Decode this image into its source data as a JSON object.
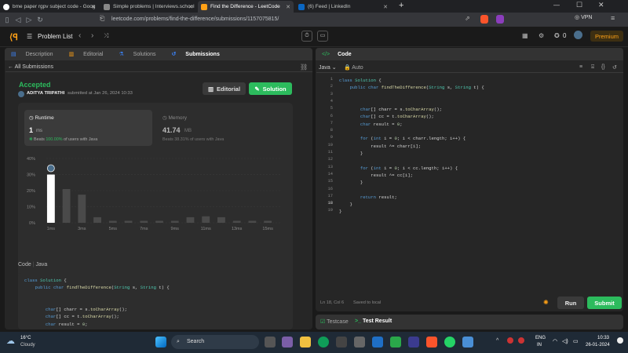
{
  "browser": {
    "tabs": [
      {
        "title": "bme paper rgpv subject code - Goog",
        "color": "#ffffff"
      },
      {
        "title": "Simple problems | Interviews.school",
        "color": "#bbbbbb"
      },
      {
        "title": "Find the Difference - LeetCode",
        "color": "#ffa116"
      },
      {
        "title": "(6) Feed | LinkedIn",
        "color": "#0a66c2"
      }
    ],
    "url": "leetcode.com/problems/find-the-difference/submissions/1157075815/",
    "vpn": "VPN"
  },
  "header": {
    "problem_list": "Problem List",
    "streak": "0",
    "premium": "Premium"
  },
  "left": {
    "tabs": [
      "Description",
      "Editorial",
      "Solutions",
      "Submissions"
    ],
    "back": "All Submissions",
    "status": "Accepted",
    "user": "ADITYA TRIPATHI",
    "submitted": "submitted at Jan 26, 2024 10:33",
    "editorial_btn": "Editorial",
    "solution_btn": "Solution",
    "runtime": {
      "label": "Runtime",
      "value": "1",
      "unit": "ms",
      "beats_prefix": "Beats",
      "beats_pct": "100.00%",
      "beats_suffix": "of users with Java"
    },
    "memory": {
      "label": "Memory",
      "value": "41.74",
      "unit": "MB",
      "beats": "Beats 38.31% of users with Java"
    },
    "code_label": "Code",
    "lang": "Java"
  },
  "chart_data": {
    "type": "bar",
    "categories": [
      "1ms",
      "2ms",
      "3ms",
      "4ms",
      "5ms",
      "6ms",
      "7ms",
      "8ms",
      "9ms",
      "10ms",
      "11ms",
      "12ms",
      "13ms",
      "14ms",
      "15ms"
    ],
    "x_tick_labels": [
      "1ms",
      "3ms",
      "5ms",
      "7ms",
      "9ms",
      "11ms",
      "13ms",
      "15ms"
    ],
    "values": [
      30,
      21,
      17.5,
      3.5,
      1.2,
      1.2,
      1.2,
      1.2,
      1.2,
      3.5,
      4,
      3.5,
      1.2,
      1.2,
      1.2
    ],
    "highlight_index": 0,
    "ylim": [
      0,
      40
    ],
    "y_ticks": [
      "40%",
      "30%",
      "20%",
      "10%",
      "0%"
    ],
    "grid": true
  },
  "editor": {
    "lang": "Java",
    "mode": "Auto",
    "status": "Ln 18, Col 6",
    "saved": "Saved to local",
    "run": "Run",
    "submit": "Submit",
    "testcase": "Testcase",
    "test_result": "Test Result"
  },
  "taskbar": {
    "temp": "16°C",
    "weather": "Cloudy",
    "search": "Search",
    "lang1": "ENG",
    "lang2": "IN",
    "time": "10:33",
    "date": "26-01-2024"
  }
}
